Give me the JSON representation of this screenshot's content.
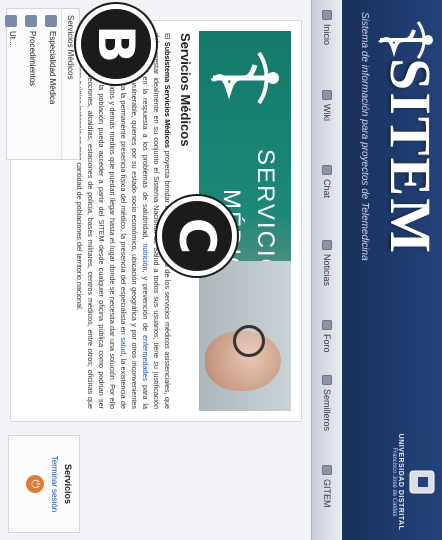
{
  "header": {
    "brand": "SITEM",
    "tagline": "Sistema de información para proyectos de Telemedicina",
    "university": "UNIVERSIDAD DISTRITAL",
    "university_sub": "Francisco José de Caldas"
  },
  "nav": [
    {
      "label": "Inicio",
      "icon": "home-icon"
    },
    {
      "label": "Wiki",
      "icon": "book-icon"
    },
    {
      "label": "Chat",
      "icon": "chat-icon"
    },
    {
      "label": "Noticias",
      "icon": "news-icon"
    },
    {
      "label": "Foro",
      "icon": "forum-icon"
    },
    {
      "label": "Semilleros",
      "icon": "group-icon"
    },
    {
      "label": "GITEM",
      "icon": "team-icon"
    }
  ],
  "sidebar": {
    "menu_title": "Servicios Médicos",
    "items": [
      {
        "label": "Especialidad Médica",
        "icon": "stethoscope-icon"
      },
      {
        "label": "Procedimientos",
        "icon": "tools-icon"
      },
      {
        "label": "Ut...",
        "icon": "table-icon"
      }
    ]
  },
  "services_box": {
    "title": "Servicios",
    "logout_label": "Terminar sesión",
    "logout_icon": "power-icon"
  },
  "hero": {
    "line1": "SERVICIOS",
    "line2": "MÉDICOS"
  },
  "main": {
    "title": "Servicios Médicos",
    "paragraph_intro": "El ",
    "paragraph_bold": "Subsistema Servicios Médicos",
    "paragraph_p1": " proyecta brindar información acerca de los servicios médicos asistenciales, que debe prestar idealmente en su conjunto el Sistema Nacional de Salud a todos sus usuarios; tiene su justificación fundamental en la respuesta a los problemas de salubridad, ",
    "link1": "nutrición",
    "paragraph_p2": ", y prevención de ",
    "link2": "enfermedades",
    "paragraph_p3": " para la población más vulnerable, quienes por su estado socio económico, ubicación geográfica y por otros inconvenientes se les imposibilita la permanente presencia física del médico, la presencia del especialista en ",
    "link3": "salud",
    "paragraph_p4": ", la existencia de los equipos médicos y demás medios que puedan llegar hasta el lugar donde se necesita dar una solución. Por ello se espera que la población pueda acceder a partir del SITEM desde cualquier oficina pública como podrían ser colegios, inspecciones, alcaldías, estaciones de policía, bases militares, centros médicos, entre otros; oficinas que son la primera o única instancia en gran cantidad de poblaciones del territorio nacional."
  },
  "markers": {
    "b": "B",
    "c": "C"
  },
  "colors": {
    "header_bg": "#1d3868",
    "hero_bg": "#1d8877",
    "link": "#1f4fb0",
    "marker_bg": "#1b1b1b"
  }
}
